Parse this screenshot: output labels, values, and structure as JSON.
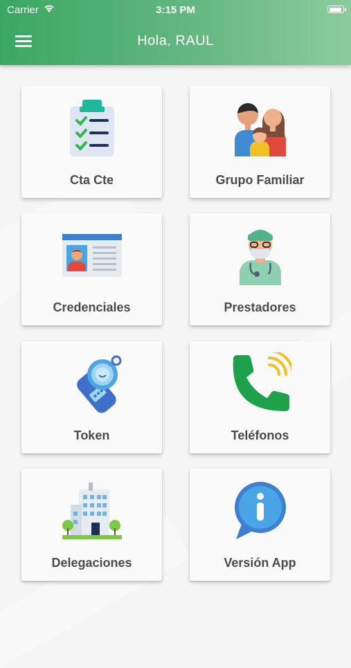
{
  "status_bar": {
    "carrier": "Carrier",
    "time": "3:15 PM"
  },
  "header": {
    "title": "Hola, RAUL"
  },
  "menu": [
    {
      "label": "Cta Cte",
      "icon": "clipboard-checklist-icon"
    },
    {
      "label": "Grupo Familiar",
      "icon": "family-icon"
    },
    {
      "label": "Credenciales",
      "icon": "id-card-icon"
    },
    {
      "label": "Prestadores",
      "icon": "doctor-icon"
    },
    {
      "label": "Token",
      "icon": "token-device-icon"
    },
    {
      "label": "Teléfonos",
      "icon": "phone-icon"
    },
    {
      "label": "Delegaciones",
      "icon": "building-icon"
    },
    {
      "label": "Versión App",
      "icon": "info-bubble-icon"
    }
  ],
  "colors": {
    "header_start": "#3aa764",
    "header_end": "#8ccb9e",
    "card_bg": "#fafafa",
    "label": "#4a4a4a"
  }
}
